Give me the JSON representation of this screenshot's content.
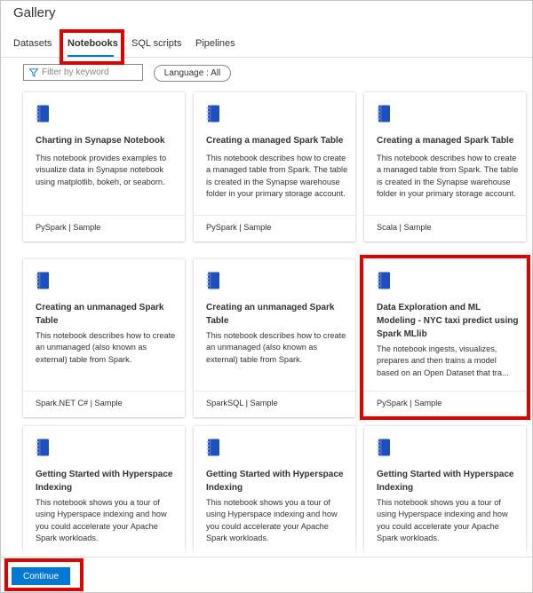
{
  "window": {
    "title": "Gallery"
  },
  "tabs": [
    {
      "label": "Datasets",
      "active": false
    },
    {
      "label": "Notebooks",
      "active": true
    },
    {
      "label": "SQL scripts",
      "active": false
    },
    {
      "label": "Pipelines",
      "active": false
    }
  ],
  "filter": {
    "placeholder": "Filter by keyword",
    "language_label": "Language : All"
  },
  "colors": {
    "accent": "#0078d4",
    "highlight": "#e00000",
    "notebook_icon": "#1e4fbf"
  },
  "cards": [
    {
      "icon": "notebook-icon",
      "title": "Charting in Synapse Notebook",
      "description": "This notebook provides examples to visualize data in Synapse notebook using matplotlib, bokeh, or seaborn.",
      "footer": "PySpark | Sample"
    },
    {
      "icon": "notebook-icon",
      "title": "Creating a managed Spark Table",
      "description": "This notebook describes how to create a managed table from Spark. The table is created in the Synapse warehouse folder in your primary storage account.",
      "footer": "PySpark | Sample"
    },
    {
      "icon": "notebook-icon",
      "title": "Creating a managed Spark Table",
      "description": "This notebook describes how to create a managed table from Spark. The table is created in the Synapse warehouse folder in your primary storage account.",
      "footer": "Scala | Sample"
    },
    {
      "icon": "notebook-icon",
      "title": "Creating an unmanaged Spark Table",
      "description": "This notebook describes how to create an unmanaged (also known as external) table from Spark.",
      "footer": "Spark.NET C# | Sample"
    },
    {
      "icon": "notebook-icon",
      "title": "Creating an unmanaged Spark Table",
      "description": "This notebook describes how to create an unmanaged (also known as external) table from Spark.",
      "footer": "SparkSQL | Sample"
    },
    {
      "icon": "notebook-icon",
      "title": "Data Exploration and ML Modeling - NYC taxi predict using Spark MLlib",
      "description": "The notebook ingests, visualizes, prepares and then trains a model based on an Open Dataset that tra...",
      "footer": "PySpark | Sample"
    },
    {
      "icon": "notebook-icon",
      "title": "Getting Started with Hyperspace Indexing",
      "description": "This notebook shows you a tour of using Hyperspace indexing and how you could accelerate your Apache Spark workloads.",
      "footer": ""
    },
    {
      "icon": "notebook-icon",
      "title": "Getting Started with Hyperspace Indexing",
      "description": "This notebook shows you a tour of using Hyperspace indexing and how you could accelerate your Apache Spark workloads.",
      "footer": ""
    },
    {
      "icon": "notebook-icon",
      "title": "Getting Started with Hyperspace Indexing",
      "description": "This notebook shows you a tour of using Hyperspace indexing and how you could accelerate your Apache Spark workloads.",
      "footer": ""
    }
  ],
  "footer": {
    "continue_label": "Continue"
  }
}
